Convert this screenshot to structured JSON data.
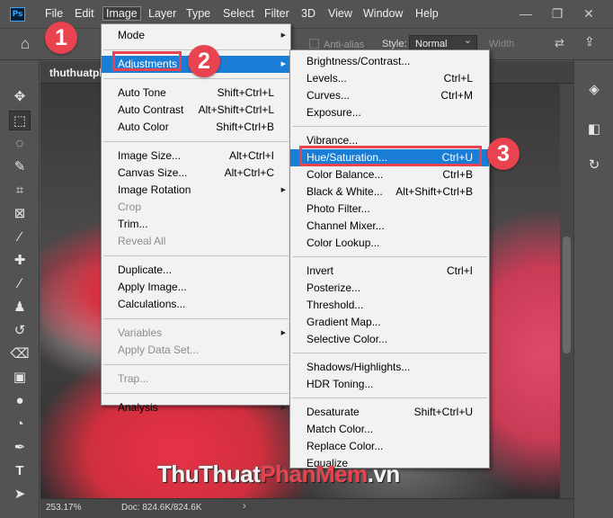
{
  "app": {
    "logo_text": "Ps"
  },
  "menubar": {
    "items": [
      "File",
      "Edit",
      "Image",
      "Layer",
      "Type",
      "Select",
      "Filter",
      "3D",
      "View",
      "Window",
      "Help"
    ],
    "window_controls": {
      "minimize": "—",
      "restore": "❐",
      "close": "✕"
    }
  },
  "options_bar": {
    "home_icon": "⌂",
    "anti_alias": "Anti-alias",
    "style_label": "Style:",
    "style_value": "Normal",
    "width_label": "Width",
    "swap_icon": "⇄",
    "share_icon": "⇪"
  },
  "document": {
    "tab_title": "thuthuatpl",
    "zoom": "253.17%",
    "doc_size": "Doc: 824.6K/824.6K",
    "status_arrow": "›"
  },
  "tools": {
    "move": "✥",
    "marquee": "⬚",
    "lasso": "◌",
    "quick_select": "✎",
    "crop": "⌗",
    "frame": "⊠",
    "eyedropper": "⁄",
    "healing": "✚",
    "brush": "∕",
    "stamp": "♟",
    "history_brush": "↺",
    "eraser": "⌫",
    "gradient": "▣",
    "blur": "●",
    "dodge": "◔",
    "pen": "✒",
    "type": "T",
    "path_select": "➤"
  },
  "right_panel": {
    "icons": [
      "◈",
      "◧",
      "↻"
    ]
  },
  "image_menu": {
    "groups": [
      [
        {
          "label": "Mode",
          "submenu": true
        }
      ],
      [
        {
          "label": "Adjustments",
          "submenu": true,
          "highlighted": true
        }
      ],
      [
        {
          "label": "Auto Tone",
          "shortcut": "Shift+Ctrl+L"
        },
        {
          "label": "Auto Contrast",
          "shortcut": "Alt+Shift+Ctrl+L"
        },
        {
          "label": "Auto Color",
          "shortcut": "Shift+Ctrl+B"
        }
      ],
      [
        {
          "label": "Image Size...",
          "shortcut": "Alt+Ctrl+I"
        },
        {
          "label": "Canvas Size...",
          "shortcut": "Alt+Ctrl+C"
        },
        {
          "label": "Image Rotation",
          "submenu": true
        },
        {
          "label": "Crop",
          "disabled": true
        },
        {
          "label": "Trim..."
        },
        {
          "label": "Reveal All",
          "disabled": true
        }
      ],
      [
        {
          "label": "Duplicate..."
        },
        {
          "label": "Apply Image..."
        },
        {
          "label": "Calculations..."
        }
      ],
      [
        {
          "label": "Variables",
          "submenu": true,
          "disabled": true
        },
        {
          "label": "Apply Data Set...",
          "disabled": true
        }
      ],
      [
        {
          "label": "Trap...",
          "disabled": true
        }
      ],
      [
        {
          "label": "Analysis",
          "submenu": true
        }
      ]
    ]
  },
  "adjustments_menu": {
    "groups": [
      [
        {
          "label": "Brightness/Contrast..."
        },
        {
          "label": "Levels...",
          "shortcut": "Ctrl+L"
        },
        {
          "label": "Curves...",
          "shortcut": "Ctrl+M"
        },
        {
          "label": "Exposure..."
        }
      ],
      [
        {
          "label": "Vibrance..."
        },
        {
          "label": "Hue/Saturation...",
          "shortcut": "Ctrl+U",
          "highlighted": true
        },
        {
          "label": "Color Balance...",
          "shortcut": "Ctrl+B"
        },
        {
          "label": "Black & White...",
          "shortcut": "Alt+Shift+Ctrl+B"
        },
        {
          "label": "Photo Filter..."
        },
        {
          "label": "Channel Mixer..."
        },
        {
          "label": "Color Lookup..."
        }
      ],
      [
        {
          "label": "Invert",
          "shortcut": "Ctrl+I"
        },
        {
          "label": "Posterize..."
        },
        {
          "label": "Threshold..."
        },
        {
          "label": "Gradient Map..."
        },
        {
          "label": "Selective Color..."
        }
      ],
      [
        {
          "label": "Shadows/Highlights..."
        },
        {
          "label": "HDR Toning..."
        }
      ],
      [
        {
          "label": "Desaturate",
          "shortcut": "Shift+Ctrl+U"
        },
        {
          "label": "Match Color..."
        },
        {
          "label": "Replace Color..."
        },
        {
          "label": "Equalize"
        }
      ]
    ]
  },
  "callouts": [
    "1",
    "2",
    "3"
  ],
  "watermark": {
    "part1": "ThuThuat",
    "part2": "PhanMem",
    "part3": ".vn"
  },
  "colors": {
    "accent": "#e8434f",
    "menu_highlight": "#1a7ed6"
  }
}
